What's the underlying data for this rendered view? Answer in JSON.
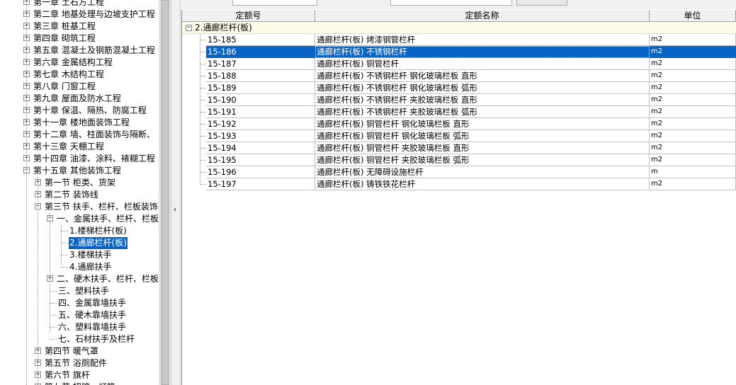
{
  "tree": {
    "items": [
      {
        "label": "第一章 土石方工程",
        "level": 0,
        "expander": "+"
      },
      {
        "label": "第二章 地基处理与边坡支护工程",
        "level": 0,
        "expander": "+"
      },
      {
        "label": "第三章 桩基工程",
        "level": 0,
        "expander": "+"
      },
      {
        "label": "第四章 砌筑工程",
        "level": 0,
        "expander": "+"
      },
      {
        "label": "第五章 混凝土及钢筋混凝土工程",
        "level": 0,
        "expander": "+"
      },
      {
        "label": "第六章 金属结构工程",
        "level": 0,
        "expander": "+"
      },
      {
        "label": "第七章 木结构工程",
        "level": 0,
        "expander": "+"
      },
      {
        "label": "第八章 门窗工程",
        "level": 0,
        "expander": "+"
      },
      {
        "label": "第九章 屋面及防水工程",
        "level": 0,
        "expander": "+"
      },
      {
        "label": "第十章 保温、隔热、防腐工程",
        "level": 0,
        "expander": "+"
      },
      {
        "label": "第十一章 楼地面装饰工程",
        "level": 0,
        "expander": "+"
      },
      {
        "label": "第十二章 墙、柱面装饰与隔断、",
        "level": 0,
        "expander": "+"
      },
      {
        "label": "第十三章 天棚工程",
        "level": 0,
        "expander": "+"
      },
      {
        "label": "第十四章 油漆、涂料、裱糊工程",
        "level": 0,
        "expander": "+"
      },
      {
        "label": "第十五章 其他装饰工程",
        "level": 0,
        "expander": "−"
      },
      {
        "label": "第一节 柜类、货架",
        "level": 1,
        "expander": "+"
      },
      {
        "label": "第二节 装饰线",
        "level": 1,
        "expander": "+"
      },
      {
        "label": "第三节 扶手、栏杆、栏板装饰",
        "level": 1,
        "expander": "−"
      },
      {
        "label": "一、金属扶手、栏杆、栏板",
        "level": 2,
        "expander": "−"
      },
      {
        "label": "1.楼梯栏杆(板)",
        "level": 3,
        "expander": ""
      },
      {
        "label": "2.通廊栏杆(板)",
        "level": 3,
        "expander": "",
        "selected": true
      },
      {
        "label": "3.楼梯扶手",
        "level": 3,
        "expander": ""
      },
      {
        "label": "4.通廊扶手",
        "level": 3,
        "expander": ""
      },
      {
        "label": "二、硬木扶手、栏杆、栏板",
        "level": 2,
        "expander": "+"
      },
      {
        "label": "三、塑料扶手",
        "level": 2,
        "expander": ""
      },
      {
        "label": "四、金属靠墙扶手",
        "level": 2,
        "expander": ""
      },
      {
        "label": "五、硬木靠墙扶手",
        "level": 2,
        "expander": ""
      },
      {
        "label": "六、塑料靠墙扶手",
        "level": 2,
        "expander": ""
      },
      {
        "label": "七、石材扶手及栏杆",
        "level": 2,
        "expander": ""
      },
      {
        "label": "第四节 暖气罩",
        "level": 1,
        "expander": "+"
      },
      {
        "label": "第五节 浴厕配件",
        "level": 1,
        "expander": "+"
      },
      {
        "label": "第六节 旗杆",
        "level": 1,
        "expander": "+"
      },
      {
        "label": "第七节 招牌、灯箱",
        "level": 1,
        "expander": "+"
      }
    ]
  },
  "grid": {
    "columns": [
      "定额号",
      "定额名称",
      "单位"
    ],
    "group": {
      "label": "2.通廊栏杆(板)",
      "expander": "−"
    },
    "rows": [
      {
        "code": "15-185",
        "name": "通廊栏杆(板) 烤漆钢管栏杆",
        "unit": "m2"
      },
      {
        "code": "15-186",
        "name": "通廊栏杆(板) 不锈钢栏杆",
        "unit": "m2",
        "selected": true
      },
      {
        "code": "15-187",
        "name": "通廊栏杆(板) 铜管栏杆",
        "unit": "m2"
      },
      {
        "code": "15-188",
        "name": "通廊栏杆(板) 不锈钢栏杆 钢化玻璃栏板 直形",
        "unit": "m2"
      },
      {
        "code": "15-189",
        "name": "通廊栏杆(板) 不锈钢栏杆 钢化玻璃栏板 弧形",
        "unit": "m2"
      },
      {
        "code": "15-190",
        "name": "通廊栏杆(板) 不锈钢栏杆 夹胶玻璃栏板 直形",
        "unit": "m2"
      },
      {
        "code": "15-191",
        "name": "通廊栏杆(板) 不锈钢栏杆 夹胶玻璃栏板 弧形",
        "unit": "m2"
      },
      {
        "code": "15-192",
        "name": "通廊栏杆(板) 铜管栏杆 钢化玻璃栏板 直形",
        "unit": "m2"
      },
      {
        "code": "15-193",
        "name": "通廊栏杆(板) 铜管栏杆 钢化玻璃栏板 弧形",
        "unit": "m2"
      },
      {
        "code": "15-194",
        "name": "通廊栏杆(板) 铜管栏杆 夹胶玻璃栏板 直形",
        "unit": "m2"
      },
      {
        "code": "15-195",
        "name": "通廊栏杆(板) 铜管栏杆 夹胶玻璃栏板 弧形",
        "unit": "m2"
      },
      {
        "code": "15-196",
        "name": "通廊栏杆(板) 无障碍设施栏杆",
        "unit": "m"
      },
      {
        "code": "15-197",
        "name": "通廊栏杆(板) 铸铁铁花栏杆",
        "unit": "m2"
      }
    ]
  },
  "colors": {
    "selection": "#0a64c8",
    "group_bg": "#fdfce8",
    "header_bg": "#f0f0f0"
  }
}
